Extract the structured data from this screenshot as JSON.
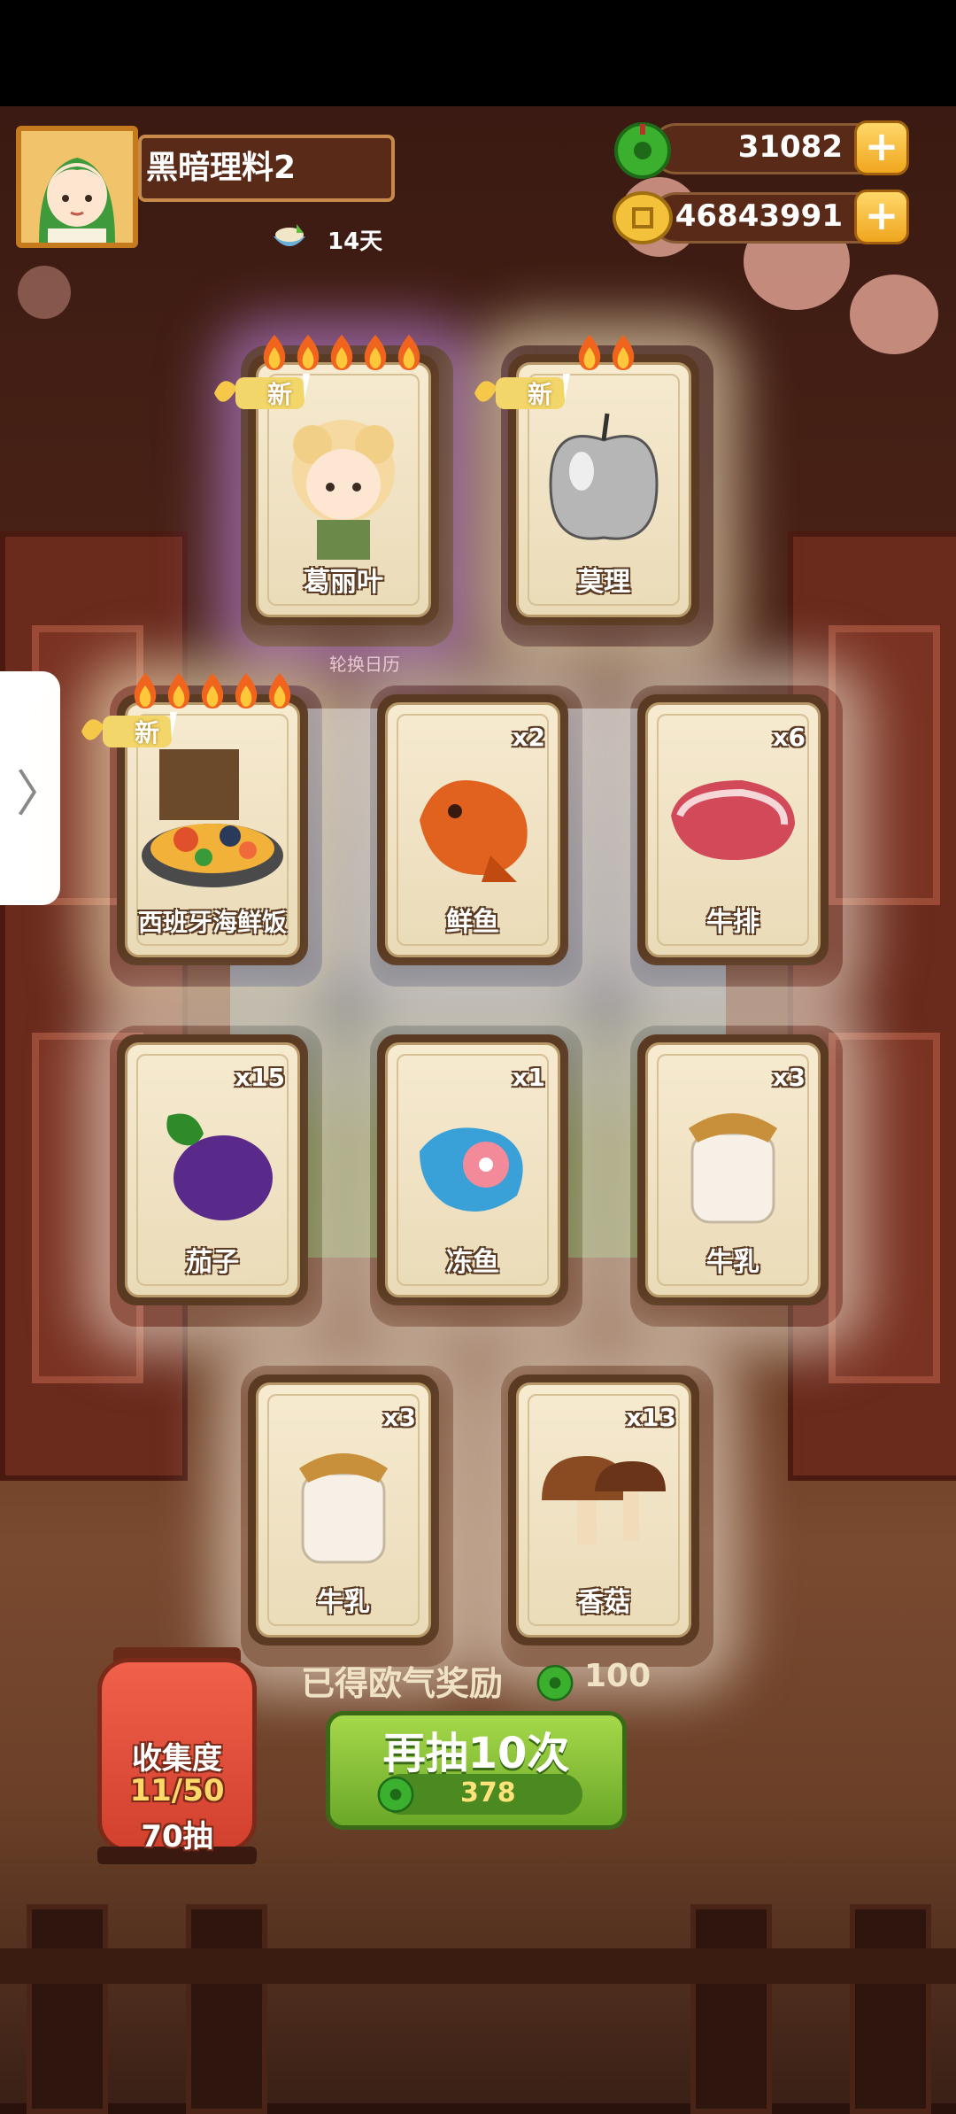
{
  "player": {
    "name": "黑暗理料2",
    "days": "14天"
  },
  "currency": {
    "jade": "31082",
    "coins": "46843991",
    "plus": "+"
  },
  "calendar_label": "轮换日历",
  "badges": {
    "new": "新"
  },
  "cards": [
    {
      "label": "葛丽叶",
      "count": "",
      "flames": 5,
      "is_new": true
    },
    {
      "label": "莫理",
      "count": "",
      "flames": 2,
      "is_new": true
    },
    {
      "label": "西班牙海鲜饭",
      "count": "",
      "flames": 5,
      "is_new": true
    },
    {
      "label": "鲜鱼",
      "count": "x2",
      "flames": 0,
      "is_new": false
    },
    {
      "label": "牛排",
      "count": "x6",
      "flames": 0,
      "is_new": false
    },
    {
      "label": "茄子",
      "count": "x15",
      "flames": 0,
      "is_new": false
    },
    {
      "label": "冻鱼",
      "count": "x1",
      "flames": 0,
      "is_new": false
    },
    {
      "label": "牛乳",
      "count": "x3",
      "flames": 0,
      "is_new": false
    },
    {
      "label": "牛乳",
      "count": "x3",
      "flames": 0,
      "is_new": false
    },
    {
      "label": "香菇",
      "count": "x13",
      "flames": 0,
      "is_new": false
    }
  ],
  "reward": {
    "text": "已得欧气奖励",
    "amount": "100"
  },
  "draw": {
    "label": "再抽10次",
    "cost": "378"
  },
  "collection": {
    "title": "收集度",
    "progress": "11/50",
    "draws": "70抽"
  },
  "side_tab_arrow": "〉",
  "colors": {
    "accent_green": "#6aa828",
    "gold": "#f0a61e",
    "lantern_red": "#d2402e",
    "card_bg": "#f6ead0"
  }
}
